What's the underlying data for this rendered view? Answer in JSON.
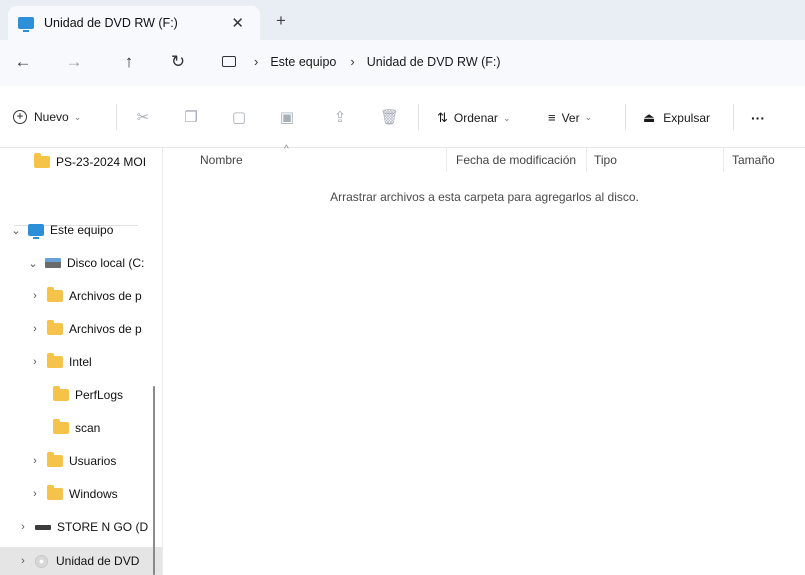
{
  "window": {
    "tab_title": "Unidad de DVD RW (F:)",
    "tab_close": "✕",
    "new_tab": "+"
  },
  "address": {
    "back": "←",
    "forward": "→",
    "up": "↑",
    "refresh": "↻",
    "crumbs": [
      "Este equipo",
      "Unidad de DVD RW (F:)"
    ]
  },
  "toolbar": {
    "new_label": "Nuevo",
    "sort_label": "Ordenar",
    "view_label": "Ver",
    "eject_label": "Expulsar",
    "more_label": "···",
    "icons": [
      "cut-icon",
      "copy-icon",
      "paste-icon",
      "rename-icon",
      "share-icon",
      "delete-icon"
    ]
  },
  "sidebar": {
    "quick_item": "PS-23-2024 MOI",
    "this_pc": "Este equipo",
    "local_disk": "Disco local (C:",
    "items": [
      {
        "label": "Archivos de p",
        "expandable": true
      },
      {
        "label": "Archivos de p",
        "expandable": true
      },
      {
        "label": "Intel",
        "expandable": true
      },
      {
        "label": "PerfLogs",
        "expandable": false
      },
      {
        "label": "scan",
        "expandable": false
      },
      {
        "label": "Usuarios",
        "expandable": true
      },
      {
        "label": "Windows",
        "expandable": true
      }
    ],
    "store_drive": "STORE N GO (D",
    "dvd_drive": "Unidad de DVD"
  },
  "columns": {
    "name": "Nombre",
    "modified": "Fecha de modificación",
    "type": "Tipo",
    "size": "Tamaño"
  },
  "content": {
    "empty_message": "Arrastrar archivos a esta carpeta para agregarlos al disco."
  },
  "colors": {
    "accent": "#2d8fd8",
    "folder": "#f5c24a",
    "selected_row": "#e5e5e5",
    "titlebar_bg": "#e9eef5"
  }
}
